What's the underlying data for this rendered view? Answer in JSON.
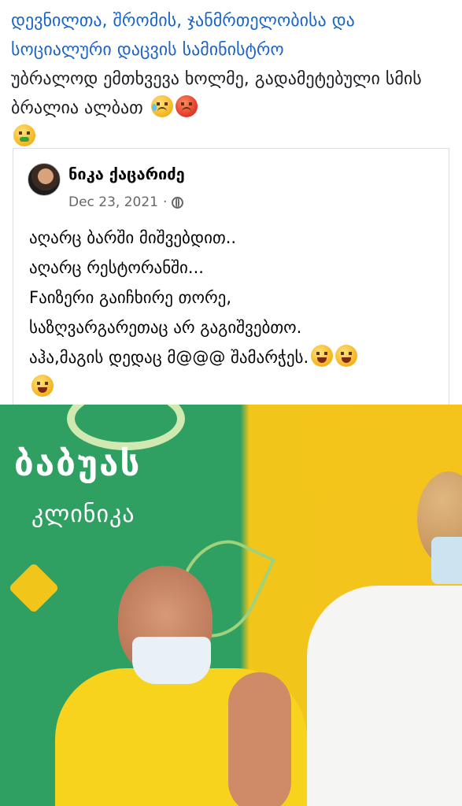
{
  "post": {
    "mention": "დევნილთა, შრომის, ჯანმრთელობისა და სოციალური დაცვის სამინისტრო",
    "text": "უბრალოდ ემთხვევა ხოლმე, გადამეტებული სმის ბრალია ალბათ",
    "emojis": [
      "sad-tear-emoji",
      "angry-face-emoji",
      "nauseated-face-emoji"
    ]
  },
  "shared_post": {
    "author": "ნიკა ქაცარიძე",
    "date": "Dec 23, 2021",
    "separator": "·",
    "lines": [
      "აღარც ბარში მიშვებდით..",
      "აღარც რესტორანში...",
      "Fაიზერი გაიჩხირე თორე,",
      "საზღვარგარეთაც არ გაგიშვებთო.",
      "აჰა,მაგის დედაც მ@@@ შამარჭეს."
    ],
    "emojis": [
      "laughing-tears-emoji",
      "laughing-tears-emoji",
      "laughing-tears-emoji"
    ]
  },
  "photo": {
    "banner_line1": "ბაბუას",
    "banner_line2": "კლინიკა",
    "colors": {
      "green": "#2f9f62",
      "yellow": "#f2c51a"
    }
  }
}
